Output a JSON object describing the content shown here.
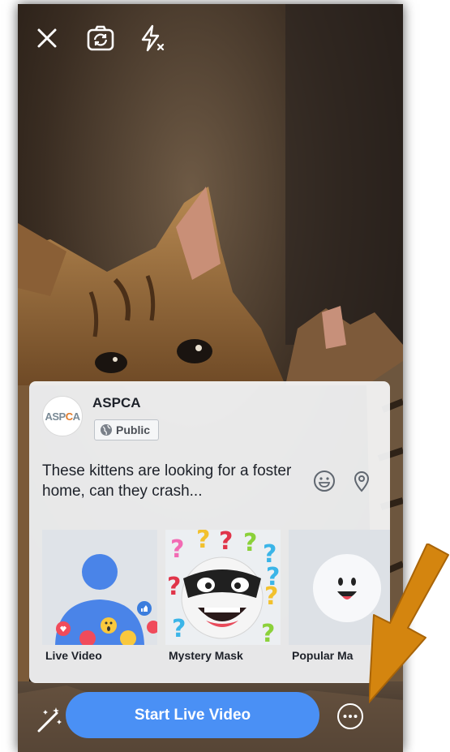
{
  "topbar": {
    "close_icon": "close-icon",
    "flip_icon": "flip-camera-icon",
    "flash_icon": "flash-off-icon"
  },
  "composer": {
    "page_name": "ASPCA",
    "avatar_logo_left": "ASP",
    "avatar_logo_mid": "C",
    "avatar_logo_right": "A",
    "privacy_label": "Public",
    "caption": "These kittens are looking for a foster home, can they crash...",
    "emoji_icon": "emoji-icon",
    "location_icon": "location-pin-icon"
  },
  "effects": [
    {
      "label": "Live Video"
    },
    {
      "label": "Mystery Mask"
    },
    {
      "label": "Popular Ma"
    }
  ],
  "bottom": {
    "start_label": "Start Live Video",
    "wand_icon": "magic-wand-icon",
    "more_icon": "more-options-icon"
  },
  "colors": {
    "primary_button": "#4a90f5",
    "annotation_arrow": "#d4850f"
  }
}
